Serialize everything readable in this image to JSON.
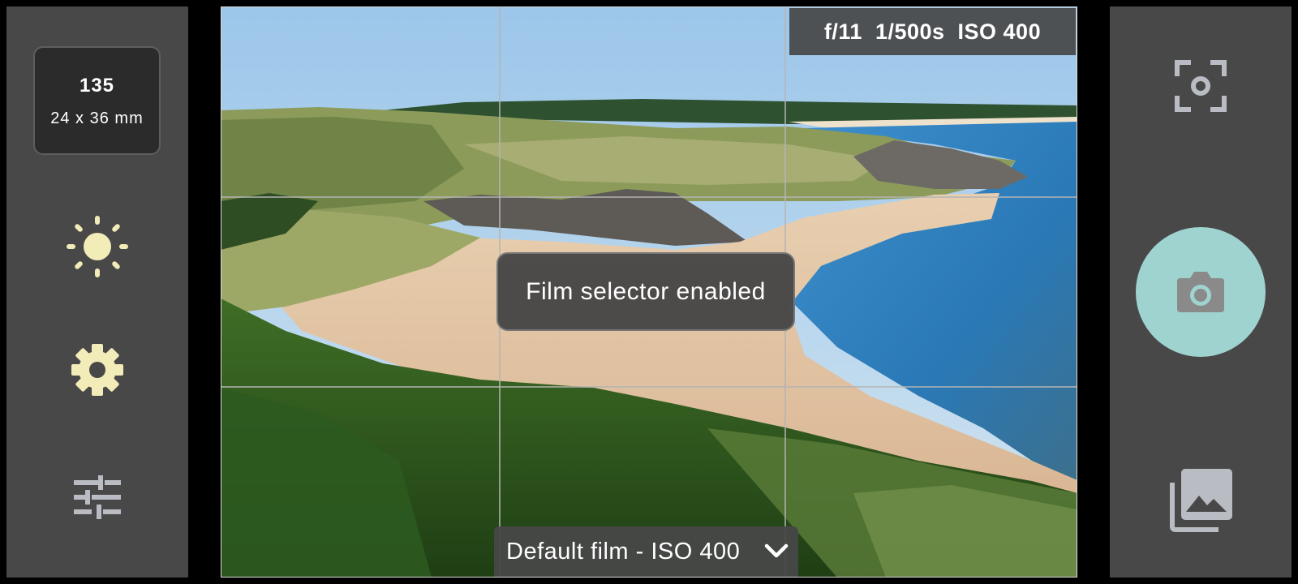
{
  "format": {
    "name": "135",
    "size": "24 x 36 mm"
  },
  "left_controls": {
    "brightness_icon": "sun-icon",
    "settings_icon": "gear-icon",
    "adjust_icon": "sliders-icon"
  },
  "exposure": {
    "aperture": "f/11",
    "shutter": "1/500s",
    "iso": "ISO 400"
  },
  "toast": {
    "message": "Film selector enabled"
  },
  "film_selector": {
    "label": "Default film - ISO 400"
  },
  "right_controls": {
    "focus_icon": "focus-frame-icon",
    "shutter_icon": "camera-icon",
    "gallery_icon": "gallery-icon"
  },
  "colors": {
    "panel": "#484848",
    "icon_accent": "#f2ecb9",
    "icon_muted": "#b9bcc2",
    "shutter": "#9fd3d0"
  }
}
